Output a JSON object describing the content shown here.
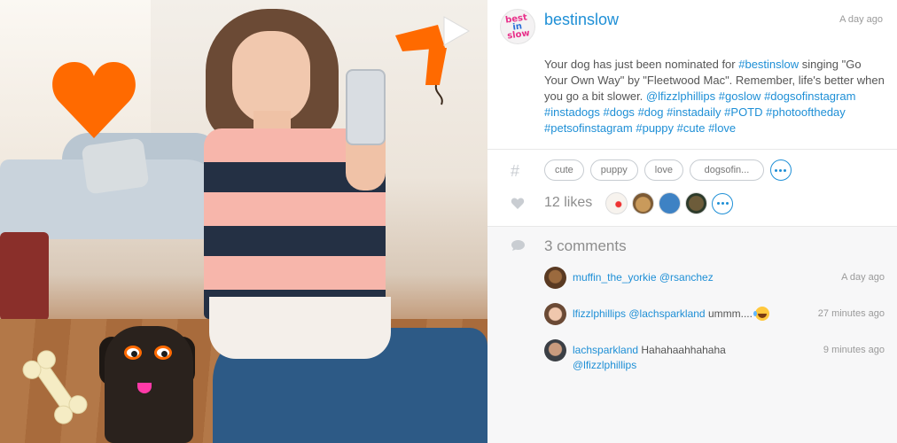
{
  "post": {
    "username": "bestinslow",
    "timestamp": "A day ago",
    "avatar_logo": [
      "best",
      "in",
      "slow"
    ],
    "caption": {
      "text_1": "Your dog has just been nominated for ",
      "tag_1": "#bestinslow",
      "text_2": " singing \"Go Your Own Way\" by \"Fleetwood Mac\". Remember, life's better when you go a bit slower. ",
      "tag_2": "@lfizzlphillips",
      "tag_3": "#goslow",
      "tag_4": "#dogsofinstagram",
      "tag_5": "#instadogs",
      "tag_6": "#dogs",
      "tag_7": "#dog",
      "tag_8": "#instadaily",
      "tag_9": "#POTD",
      "tag_10": "#photooftheday",
      "tag_11": "#petsofinstagram",
      "tag_12": "#puppy",
      "tag_13": "#cute",
      "tag_14": "#love"
    }
  },
  "tags": {
    "icon": "#",
    "items": [
      "cute",
      "puppy",
      "love",
      "dogsofin..."
    ]
  },
  "likes": {
    "icon": "heart-icon",
    "count_label": "12 likes"
  },
  "comments": {
    "icon": "speech-bubble-icon",
    "count_label": "3 comments",
    "items": [
      {
        "user": "muffin_the_yorkie",
        "mention": "@rsanchez",
        "text": "",
        "time": "A day ago"
      },
      {
        "user": "lfizzlphillips",
        "mention": "@lachsparkland",
        "text": "ummm....",
        "time": "27 minutes ago"
      },
      {
        "user": "lachsparkland",
        "mention": "@lfizzlphillips",
        "text": "Hahahaahhahaha",
        "time": "9 minutes ago"
      }
    ]
  },
  "colors": {
    "link": "#1e8fd6",
    "sticker_orange": "#ff6a00",
    "muted_text": "#8d8d8d"
  }
}
